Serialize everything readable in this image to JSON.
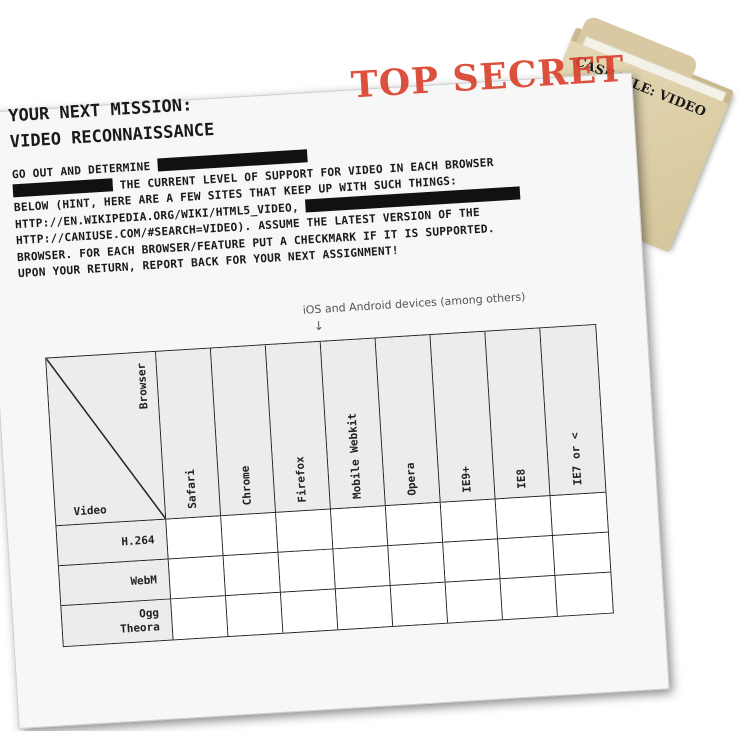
{
  "folder": {
    "label": "CASE FILE: VIDEO"
  },
  "mission": {
    "title_line1": "YOUR NEXT MISSION:",
    "title_line2": "VIDEO RECONNAISSANCE",
    "stamp": "TOP SECRET",
    "instructions": [
      "GO OUT AND DETERMINE",
      "THE CURRENT LEVEL OF SUPPORT FOR VIDEO IN EACH BROWSER",
      "BELOW (HINT, HERE ARE A FEW SITES THAT KEEP UP WITH SUCH THINGS:",
      "HTTP://EN.WIKIPEDIA.ORG/WIKI/HTML5_VIDEO,",
      "HTTP://CANIUSE.COM/#SEARCH=VIDEO). ASSUME THE LATEST VERSION OF THE",
      "BROWSER. FOR EACH BROWSER/FEATURE PUT A CHECKMARK IF IT IS SUPPORTED.",
      "UPON YOUR RETURN, REPORT BACK FOR YOUR NEXT ASSIGNMENT!"
    ],
    "annotation": "iOS and Android devices (among others)",
    "arrow": "↓"
  },
  "table": {
    "corner_browser": "Browser",
    "corner_video": "Video",
    "browsers": [
      "Safari",
      "Chrome",
      "Firefox",
      "Mobile Webkit",
      "Opera",
      "IE9+",
      "IE8",
      "IE7 or <"
    ],
    "formats": [
      "H.264",
      "WebM",
      "Ogg\nTheora"
    ]
  }
}
